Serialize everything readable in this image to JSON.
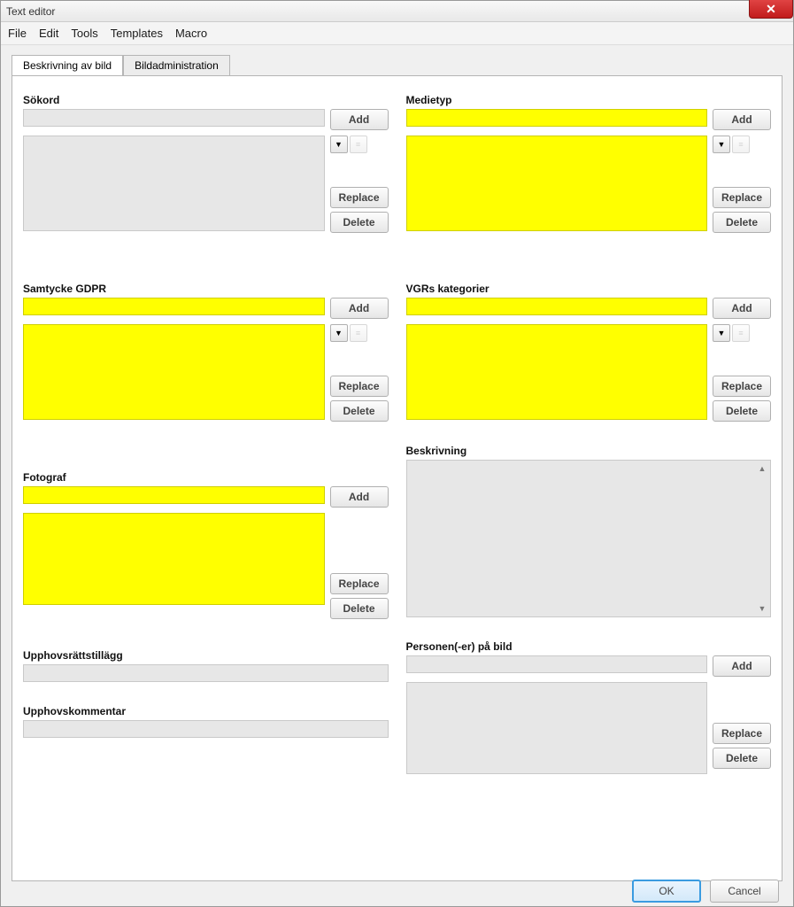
{
  "window": {
    "title": "Text editor"
  },
  "menu": {
    "file": "File",
    "edit": "Edit",
    "tools": "Tools",
    "templates": "Templates",
    "macro": "Macro"
  },
  "tabs": {
    "t1": "Beskrivning av bild",
    "t2": "Bildadministration"
  },
  "labels": {
    "sokord": "Sökord",
    "medietyp": "Medietyp",
    "samtycke": "Samtycke GDPR",
    "vgr": "VGRs kategorier",
    "fotograf": "Fotograf",
    "beskrivning": "Beskrivning",
    "upphov_tillagg": "Upphovsrättstillägg",
    "upphov_kommentar": "Upphovskommentar",
    "personen": "Personen(-er) på bild"
  },
  "buttons": {
    "add": "Add",
    "replace": "Replace",
    "delete": "Delete",
    "ok": "OK",
    "cancel": "Cancel"
  }
}
